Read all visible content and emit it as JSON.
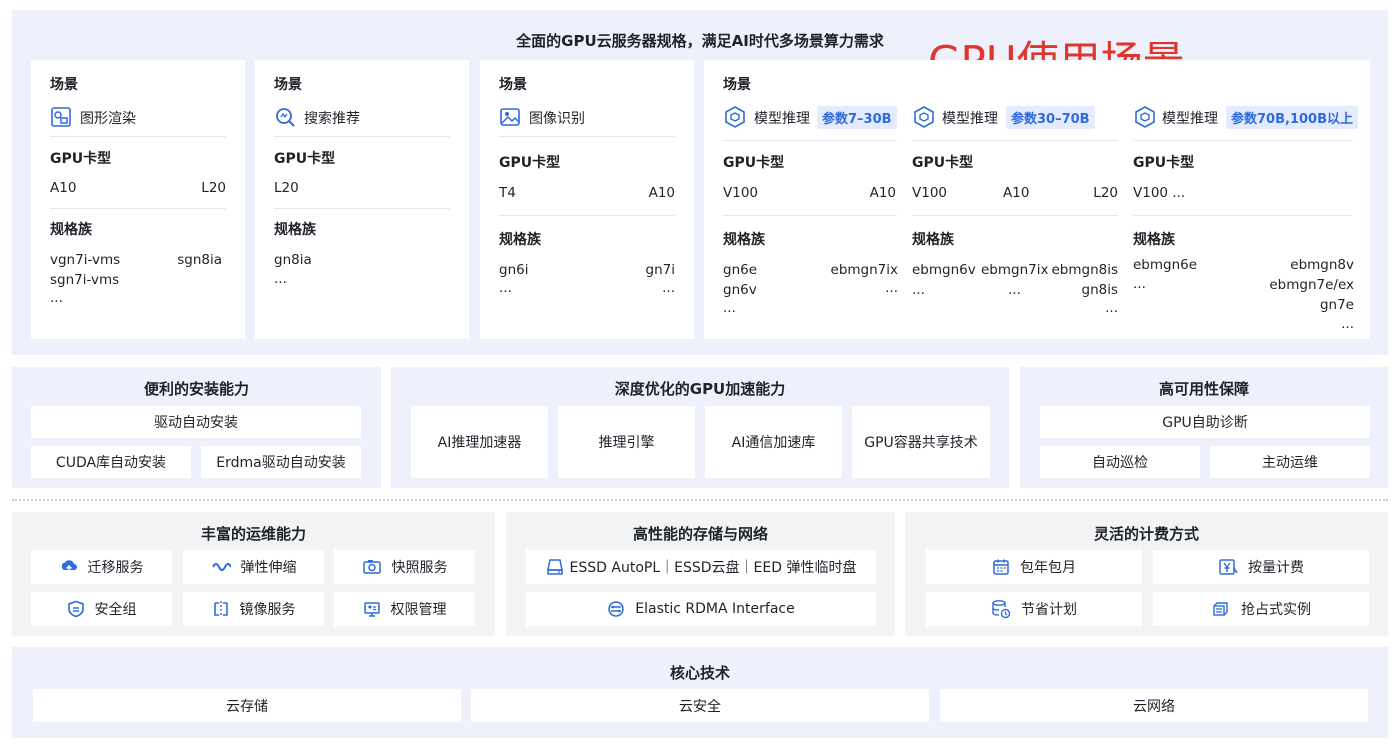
{
  "overlay_title": "GPU使用场景",
  "top": {
    "title": "全面的GPU云服务器规格，满足AI时代多场景算力需求",
    "scene_label": "场景",
    "gpu_label": "GPU卡型",
    "family_label": "规格族",
    "cards": [
      {
        "scene": "图形渲染",
        "gpu": [
          "A10",
          "L20"
        ],
        "fam_left": [
          "vgn7i-vms",
          "sgn7i-vms",
          "..."
        ],
        "fam_right": [
          "sgn8ia"
        ]
      },
      {
        "scene": "搜索推荐",
        "gpu": [
          "L20"
        ],
        "fam_left": [
          "gn8ia",
          "..."
        ],
        "fam_right": []
      },
      {
        "scene": "图像识别",
        "gpu": [
          "T4",
          "A10"
        ],
        "fam_left": [
          "gn6i",
          "..."
        ],
        "fam_right": [
          "gn7i",
          "..."
        ]
      }
    ],
    "inference": [
      {
        "scene": "模型推理",
        "badge": "参数7–30B",
        "gpu": [
          "V100",
          "A10"
        ],
        "fam_col1": [
          "gn6e",
          "gn6v",
          "..."
        ],
        "fam_col2": [
          "ebmgn7ix",
          "..."
        ]
      },
      {
        "scene": "模型推理",
        "badge": "参数30–70B",
        "gpu": [
          "V100",
          "A10",
          "L20"
        ],
        "fam_col1": [
          "ebmgn6v",
          "..."
        ],
        "fam_col2": [
          "ebmgn7ix",
          "..."
        ],
        "fam_col3": [
          "ebmgn8is",
          "gn8is",
          "..."
        ]
      },
      {
        "scene": "模型推理",
        "badge": "参数70B,100B以上",
        "gpu": [
          "V100 ..."
        ],
        "fam_col1": [
          "ebmgn6e",
          "..."
        ],
        "fam_col2": [
          "ebmgn8v",
          "ebmgn7e/ex",
          "gn7e",
          "..."
        ]
      }
    ]
  },
  "install": {
    "title": "便利的安装能力",
    "items": [
      "驱动自动安装",
      "CUDA库自动安装",
      "Erdma驱动自动安装"
    ]
  },
  "accel": {
    "title": "深度优化的GPU加速能力",
    "items": [
      "AI推理加速器",
      "推理引擎",
      "AI通信加速库",
      "GPU容器共享技术"
    ]
  },
  "ha": {
    "title": "高可用性保障",
    "items": [
      "GPU自助诊断",
      "自动巡检",
      "主动运维"
    ]
  },
  "ops": {
    "title": "丰富的运维能力",
    "items": [
      {
        "label": "迁移服务",
        "icon": "cloud-migrate-icon"
      },
      {
        "label": "弹性伸缩",
        "icon": "wave-icon"
      },
      {
        "label": "快照服务",
        "icon": "camera-icon"
      },
      {
        "label": "安全组",
        "icon": "shield-icon"
      },
      {
        "label": "镜像服务",
        "icon": "mirror-icon"
      },
      {
        "label": "权限管理",
        "icon": "permission-icon"
      }
    ]
  },
  "storage": {
    "title": "高性能的存储与网络",
    "items": [
      {
        "label": "ESSD AutoPL｜ESSD云盘｜EED 弹性临时盘",
        "icon": "disk-icon"
      },
      {
        "label": "Elastic RDMA Interface",
        "icon": "network-icon"
      }
    ]
  },
  "billing": {
    "title": "灵活的计费方式",
    "items": [
      {
        "label": "包年包月",
        "icon": "calendar-icon"
      },
      {
        "label": "按量计费",
        "icon": "yuan-icon"
      },
      {
        "label": "节省计划",
        "icon": "database-clock-icon"
      },
      {
        "label": "抢占式实例",
        "icon": "server-stack-icon"
      }
    ]
  },
  "core": {
    "title": "核心技术",
    "items": [
      "云存储",
      "云安全",
      "云网络"
    ]
  },
  "colors": {
    "panel_blue": "#eef0fb",
    "panel_gray": "#f2f3f5",
    "badge_blue": "#2f6bdc",
    "overlay_red": "#e0352b",
    "icon_blue": "#2f6bdc"
  }
}
